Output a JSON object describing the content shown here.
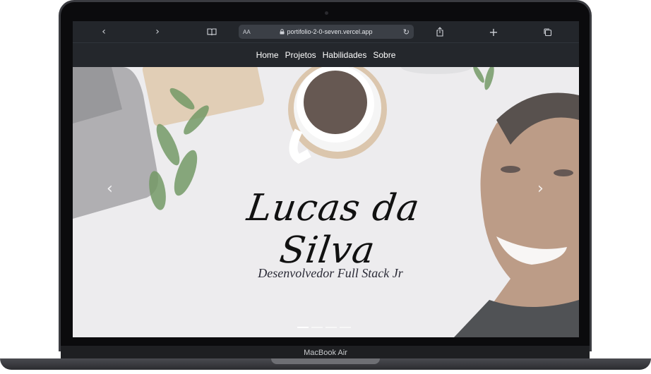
{
  "device": {
    "model_label": "MacBook Air"
  },
  "browser": {
    "back_icon": "chevron-left-icon",
    "forward_icon": "chevron-right-icon",
    "text_size_label": "AA",
    "url": "portifolio-2-0-seven.vercel.app",
    "reload_icon": "reload-icon"
  },
  "nav": {
    "items": [
      {
        "label": "Home"
      },
      {
        "label": "Projetos"
      },
      {
        "label": "Habilidades"
      },
      {
        "label": "Sobre"
      }
    ]
  },
  "hero": {
    "name": "Lucas da Silva",
    "subtitle": "Desenvolvedor Full Stack Jr",
    "prev_glyph": "‹",
    "next_glyph": "›",
    "slide_count": 4,
    "active_slide": 1
  },
  "colors": {
    "toolbar_bg": "#23262b",
    "nav_bg": "#24272c",
    "hero_bg": "#e9e8ea"
  }
}
